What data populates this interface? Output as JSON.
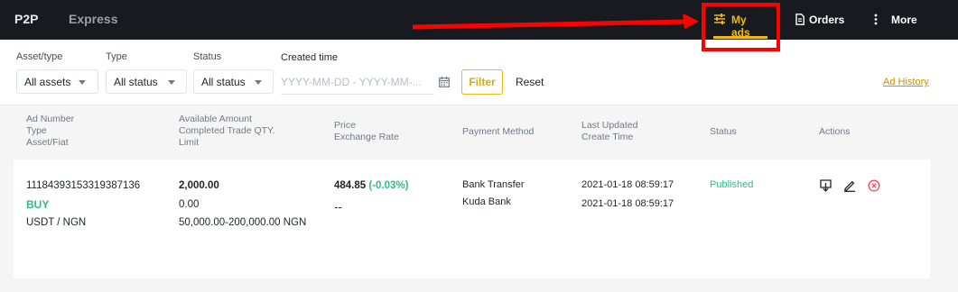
{
  "nav": {
    "p2p": "P2P",
    "express": "Express",
    "my_ads": "My ads",
    "orders": "Orders",
    "more": "More"
  },
  "filters": {
    "asset_type_label": "Asset/type",
    "asset_type_value": "All assets",
    "type_label": "Type",
    "type_value": "All status",
    "status_label": "Status",
    "status_value": "All status",
    "created_time_label": "Created time",
    "created_time_placeholder": "YYYY-MM-DD - YYYY-MM-...",
    "filter_button": "Filter",
    "reset_button": "Reset",
    "ad_history_link": "Ad History"
  },
  "table": {
    "headers": {
      "col1": [
        "Ad Number",
        "Type",
        "Asset/Fiat"
      ],
      "col2": [
        "Available Amount",
        "Completed Trade QTY.",
        "Limit"
      ],
      "col3": [
        "Price",
        "Exchange Rate"
      ],
      "col4": [
        "Payment Method"
      ],
      "col5": [
        "Last Updated",
        "Create Time"
      ],
      "col6": [
        "Status"
      ],
      "col7": [
        "Actions"
      ]
    },
    "rows": [
      {
        "ad_number": "11184393153319387136",
        "type": "BUY",
        "asset_fiat": "USDT / NGN",
        "available_amount": "2,000.00",
        "completed_qty": "0.00",
        "limit": "50,000.00-200,000.00 NGN",
        "price": "484.85",
        "price_change": "(-0.03%)",
        "exchange_rate": "--",
        "payment_methods": [
          "Bank Transfer",
          "Kuda Bank"
        ],
        "last_updated": "2021-01-18 08:59:17",
        "create_time": "2021-01-18 08:59:17",
        "status": "Published"
      }
    ]
  },
  "colors": {
    "accent": "#f0b90b",
    "buy": "#2ebd85",
    "published": "#2ebd85",
    "delete": "#f6465d",
    "annotation": "#ff0000"
  },
  "icons": {
    "my_ads": "sliders-icon",
    "orders": "document-icon",
    "more": "vertical-dots-icon",
    "calendar": "calendar-icon",
    "action_download": "download-icon",
    "action_edit": "edit-pencil-icon",
    "action_close": "close-circle-icon"
  }
}
